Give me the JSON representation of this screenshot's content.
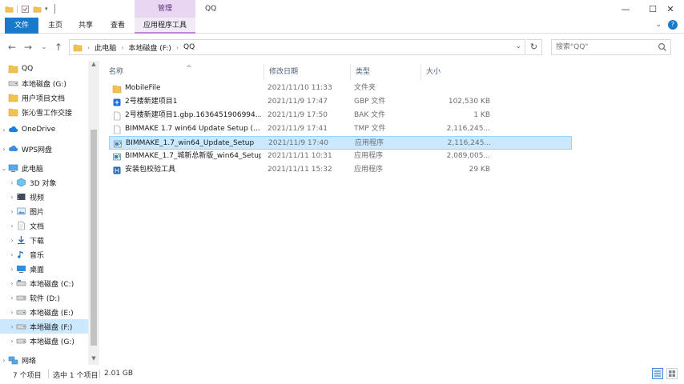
{
  "window": {
    "title": "QQ",
    "context_tab_group": "管理",
    "minimize": "—",
    "maximize": "☐",
    "close": "✕"
  },
  "ribbon": {
    "tabs": [
      {
        "label": "文件"
      },
      {
        "label": "主页"
      },
      {
        "label": "共享"
      },
      {
        "label": "查看"
      },
      {
        "label": "应用程序工具"
      }
    ]
  },
  "address": {
    "crumbs": [
      "此电脑",
      "本地磁盘 (F:)",
      "QQ"
    ],
    "search_placeholder": "搜索\"QQ\""
  },
  "nav": {
    "items": [
      {
        "label": "QQ",
        "icon": "folder-icon"
      },
      {
        "label": "本地磁盘 (G:)",
        "icon": "drive-icon"
      },
      {
        "label": "用户项目文档",
        "icon": "folder-icon"
      },
      {
        "label": "张沁雪工作交接",
        "icon": "folder-icon"
      },
      {
        "label": "OneDrive",
        "icon": "cloud-icon"
      },
      {
        "label": "WPS网盘",
        "icon": "wps-cloud-icon"
      },
      {
        "label": "此电脑",
        "icon": "pc-icon"
      },
      {
        "label": "3D 对象",
        "icon": "cube-icon"
      },
      {
        "label": "视频",
        "icon": "video-icon"
      },
      {
        "label": "图片",
        "icon": "picture-icon"
      },
      {
        "label": "文档",
        "icon": "document-icon"
      },
      {
        "label": "下载",
        "icon": "download-icon"
      },
      {
        "label": "音乐",
        "icon": "music-icon"
      },
      {
        "label": "桌面",
        "icon": "desktop-icon"
      },
      {
        "label": "本地磁盘 (C:)",
        "icon": "drive-icon"
      },
      {
        "label": "软件 (D:)",
        "icon": "drive-icon"
      },
      {
        "label": "本地磁盘 (E:)",
        "icon": "drive-icon"
      },
      {
        "label": "本地磁盘 (F:)",
        "icon": "drive-icon"
      },
      {
        "label": "本地磁盘 (G:)",
        "icon": "drive-icon"
      },
      {
        "label": "网络",
        "icon": "network-icon"
      }
    ]
  },
  "columns": {
    "name": "名称",
    "date": "修改日期",
    "type": "类型",
    "size": "大小"
  },
  "files": [
    {
      "name": "MobileFile",
      "date": "2021/11/10 11:33",
      "type": "文件夹",
      "size": "",
      "icon": "folder-icon"
    },
    {
      "name": "2号楼新建项目1",
      "date": "2021/11/9 17:47",
      "type": "GBP 文件",
      "size": "102,530 KB",
      "icon": "gbp-file-icon"
    },
    {
      "name": "2号楼新建项目1.gbp.1636451906994...",
      "date": "2021/11/9 17:50",
      "type": "BAK 文件",
      "size": "1 KB",
      "icon": "blank-file-icon"
    },
    {
      "name": "BIMMAKE 1.7 win64 Update Setup (...",
      "date": "2021/11/9 17:41",
      "type": "TMP 文件",
      "size": "2,116,245...",
      "icon": "blank-file-icon"
    },
    {
      "name": "BIMMAKE_1.7_win64_Update_Setup",
      "date": "2021/11/9 17:40",
      "type": "应用程序",
      "size": "2,116,245...",
      "icon": "installer-icon"
    },
    {
      "name": "BIMMAKE_1.7_城新总新版_win64_Setup",
      "date": "2021/11/11 10:31",
      "type": "应用程序",
      "size": "2,089,005...",
      "icon": "installer-icon"
    },
    {
      "name": "安装包校验工具",
      "date": "2021/11/11 15:32",
      "type": "应用程序",
      "size": "29 KB",
      "icon": "tool-app-icon"
    }
  ],
  "status": {
    "item_count": "7 个项目",
    "selected": "选中 1 个项目",
    "selected_size": "2.01 GB"
  }
}
